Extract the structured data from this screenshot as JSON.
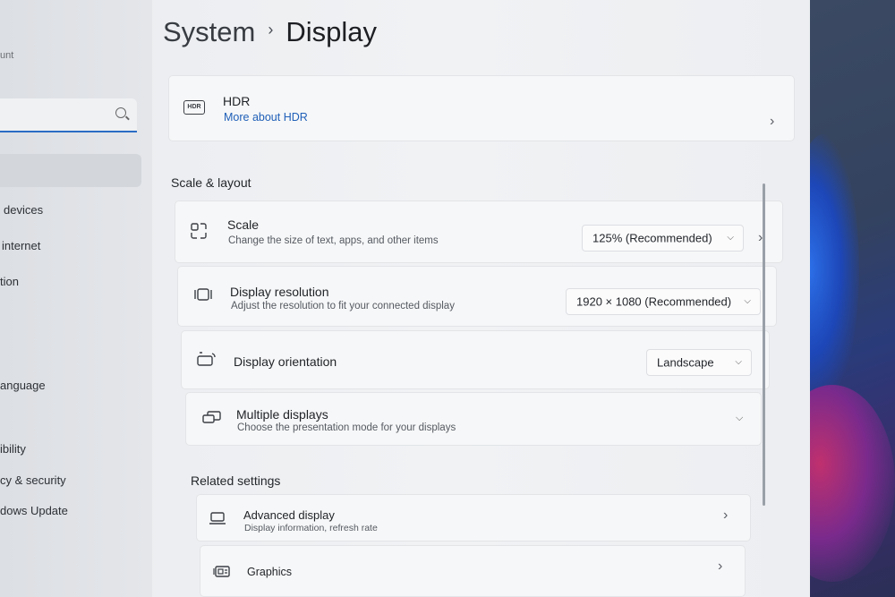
{
  "header": {
    "breadcrumb_root": "System",
    "breadcrumb_current": "Display"
  },
  "sidebar": {
    "account_fragment": "unt",
    "search_placeholder": "",
    "items": [
      {
        "label": "devices"
      },
      {
        "label": "internet"
      },
      {
        "label": "tion"
      },
      {
        "label": "anguage"
      },
      {
        "label": "ibility"
      },
      {
        "label": "cy & security"
      },
      {
        "label": "dows Update"
      }
    ]
  },
  "hdr": {
    "title": "HDR",
    "link": "More about HDR",
    "icon_text": "HDR"
  },
  "scale_layout": {
    "section_title": "Scale & layout",
    "scale": {
      "title": "Scale",
      "subtitle": "Change the size of text, apps, and other items",
      "value": "125% (Recommended)"
    },
    "resolution": {
      "title": "Display resolution",
      "subtitle": "Adjust the resolution to fit your connected display",
      "value": "1920 × 1080 (Recommended)"
    },
    "orientation": {
      "title": "Display orientation",
      "value": "Landscape"
    },
    "multiple": {
      "title": "Multiple displays",
      "subtitle": "Choose the presentation mode for your displays"
    }
  },
  "related": {
    "section_title": "Related settings",
    "advanced": {
      "title": "Advanced display",
      "subtitle": "Display information, refresh rate"
    },
    "graphics": {
      "title": "Graphics"
    }
  },
  "colors": {
    "accent": "#2b6cc4",
    "link": "#1f5fb8"
  }
}
